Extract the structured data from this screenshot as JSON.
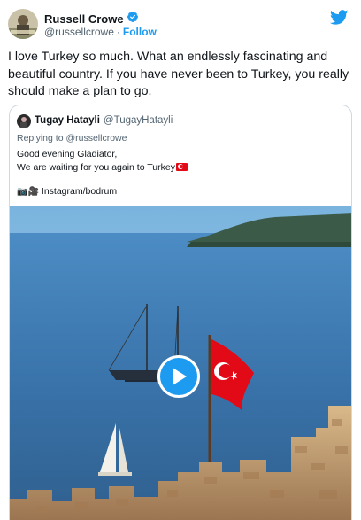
{
  "author": {
    "name": "Russell Crowe",
    "handle": "@russellcrowe",
    "separator": "·",
    "follow_label": "Follow"
  },
  "tweet": {
    "text": "I love Turkey so much. What an endlessly fascinating and beautiful country. If you have never been to Turkey, you really should make a plan to go."
  },
  "quoted": {
    "name": "Tugay Hatayli",
    "handle": "@TugayHatayli",
    "replying_to": "Replying to @russellcrowe",
    "line1": "Good evening Gladiator,",
    "line2": "We are waiting for you again to Turkey",
    "source_emoji": "📷🎥",
    "source_text": "Instagram/bodrum"
  },
  "colors": {
    "accent": "#1d9bf0",
    "flag_red": "#e30a17",
    "sea": "#3f7fb8"
  },
  "icons": {
    "brand": "twitter-bird-icon",
    "verified": "verified-badge-icon",
    "play": "play-icon"
  }
}
